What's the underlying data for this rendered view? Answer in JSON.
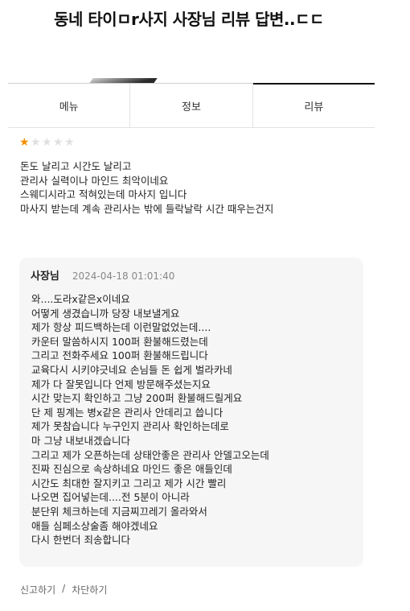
{
  "post_title": "동네 타이ㅁr사지 사장님 리뷰 답변..ㄷㄷ",
  "tabs": [
    {
      "label": "메뉴",
      "active": false
    },
    {
      "label": "정보",
      "active": false
    },
    {
      "label": "리뷰",
      "active": true
    }
  ],
  "review": {
    "rating": 1,
    "max_rating": 5,
    "star_color": "#f29100",
    "star_empty_color": "#e0e0e0",
    "lines": [
      "돈도 날리고 시간도 날리고",
      "관리사 실력이나 마인드 최악이네요",
      "스웨디시라고 적혀있는데 마사지 입니다",
      "마사지 받는데 계속 관리사는 밖에 들락날락 시간 때우는건지"
    ]
  },
  "owner_reply": {
    "author": "사장님",
    "date": "2024-04-18 01:01:40",
    "lines": [
      "와....도라x같은x이네요",
      "어떻게 생겼습니까 당장 내보낼게요",
      "제가 항상 피드백하는데 이런말없었는데....",
      "카운터 말씀하시지 100퍼 환불해드렸는데",
      "그리고 전화주세요 100퍼 환불해드립니다",
      "교육다시 시키야긋네요 손님들 돈 쉽게 벌라카네",
      "제가 다 잘못입니다 언제 방문해주셨는지요",
      "시간 맞는지 확인하고 그냥 200퍼 환불해드릴게요",
      "단 제 핑계는 병x같은 관리사 안데리고 씁니다",
      "제가 못참습니다 누구인지 관리사 확인하는데로",
      "마 그냥 내보내겠습니다",
      "그리고 제가 오픈하는데 상태안좋은 관리사 안델고오는데",
      "진짜 진심으로 속상하네요 마인드 좋은 애들인데",
      "시간도 최대한 잘지키고 그리고 제가 시간 빨리",
      "나오면 집어넣는데....전 5분이 아니라",
      "분단위 체크하는데 지금찌끄레기 올라와서",
      "애들 심페소상술좀 해야겠네요",
      "다시 한번더 죄송합니다"
    ]
  },
  "footer": {
    "report_label": "신고하기",
    "separator": "/",
    "block_label": "차단하기"
  }
}
